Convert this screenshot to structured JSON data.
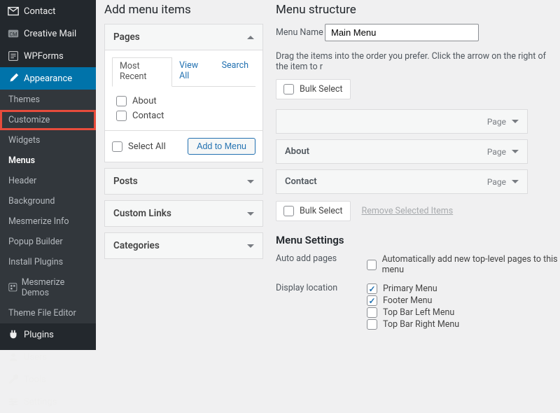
{
  "sidebar": {
    "items": [
      {
        "icon": "envelope",
        "label": "Contact"
      },
      {
        "icon": "cm",
        "label": "Creative Mail"
      },
      {
        "icon": "wpforms",
        "label": "WPForms"
      },
      {
        "icon": "brush",
        "label": "Appearance",
        "active": true
      }
    ],
    "sub": [
      {
        "label": "Themes"
      },
      {
        "label": "Customize",
        "highlight": true
      },
      {
        "label": "Widgets"
      },
      {
        "label": "Menus",
        "current": true
      },
      {
        "label": "Header"
      },
      {
        "label": "Background"
      },
      {
        "label": "Mesmerize Info"
      },
      {
        "label": "Popup Builder"
      },
      {
        "label": "Install Plugins"
      },
      {
        "label": "Mesmerize Demos",
        "icon": true
      },
      {
        "label": "Theme File Editor"
      }
    ],
    "items2": [
      {
        "icon": "plug",
        "label": "Plugins"
      },
      {
        "icon": "user",
        "label": "Users"
      },
      {
        "icon": "wrench",
        "label": "Tools"
      },
      {
        "icon": "sliders",
        "label": "Settings"
      }
    ]
  },
  "addMenu": {
    "heading": "Add menu items",
    "boxes": [
      {
        "title": "Pages",
        "open": true
      },
      {
        "title": "Posts",
        "open": false
      },
      {
        "title": "Custom Links",
        "open": false
      },
      {
        "title": "Categories",
        "open": false
      }
    ],
    "tabs": [
      "Most Recent",
      "View All",
      "Search"
    ],
    "activeTab": 0,
    "pageItems": [
      "About",
      "Contact"
    ],
    "selectAll": "Select All",
    "addBtn": "Add to Menu"
  },
  "structure": {
    "heading": "Menu structure",
    "nameLabel": "Menu Name",
    "nameValue": "Main Menu",
    "instructions": "Drag the items into the order you prefer. Click the arrow on the right of the item to r",
    "bulkSelect": "Bulk Select",
    "items": [
      {
        "title": "",
        "type": "Page"
      },
      {
        "title": "About",
        "type": "Page"
      },
      {
        "title": "Contact",
        "type": "Page"
      }
    ],
    "removeLink": "Remove Selected Items",
    "settingsHeading": "Menu Settings",
    "autoAddLabel": "Auto add pages",
    "autoAddOption": "Automatically add new top-level pages to this menu",
    "displayLabel": "Display location",
    "locations": [
      {
        "label": "Primary Menu",
        "checked": true
      },
      {
        "label": "Footer Menu",
        "checked": true
      },
      {
        "label": "Top Bar Left Menu",
        "checked": false
      },
      {
        "label": "Top Bar Right Menu",
        "checked": false
      }
    ]
  }
}
